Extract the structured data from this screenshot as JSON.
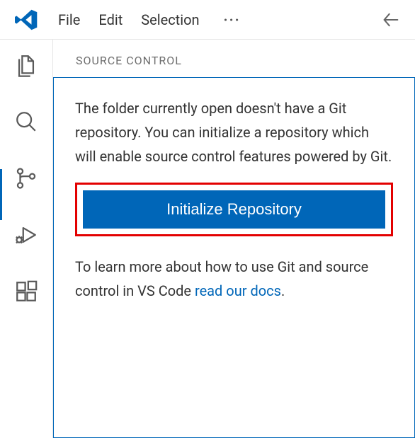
{
  "menubar": {
    "items": [
      "File",
      "Edit",
      "Selection"
    ],
    "ellipsis": "···"
  },
  "panel": {
    "title": "SOURCE CONTROL",
    "intro_text": "The folder currently open doesn't have a Git repository. You can initialize a repository which will enable source control features powered by Git.",
    "button_label": "Initialize Repository",
    "learn_prefix": "To learn more about how to use Git and source control in VS Code ",
    "learn_link": "read our docs",
    "learn_suffix": "."
  },
  "colors": {
    "accent": "#0066b8",
    "highlight": "#e30000"
  }
}
